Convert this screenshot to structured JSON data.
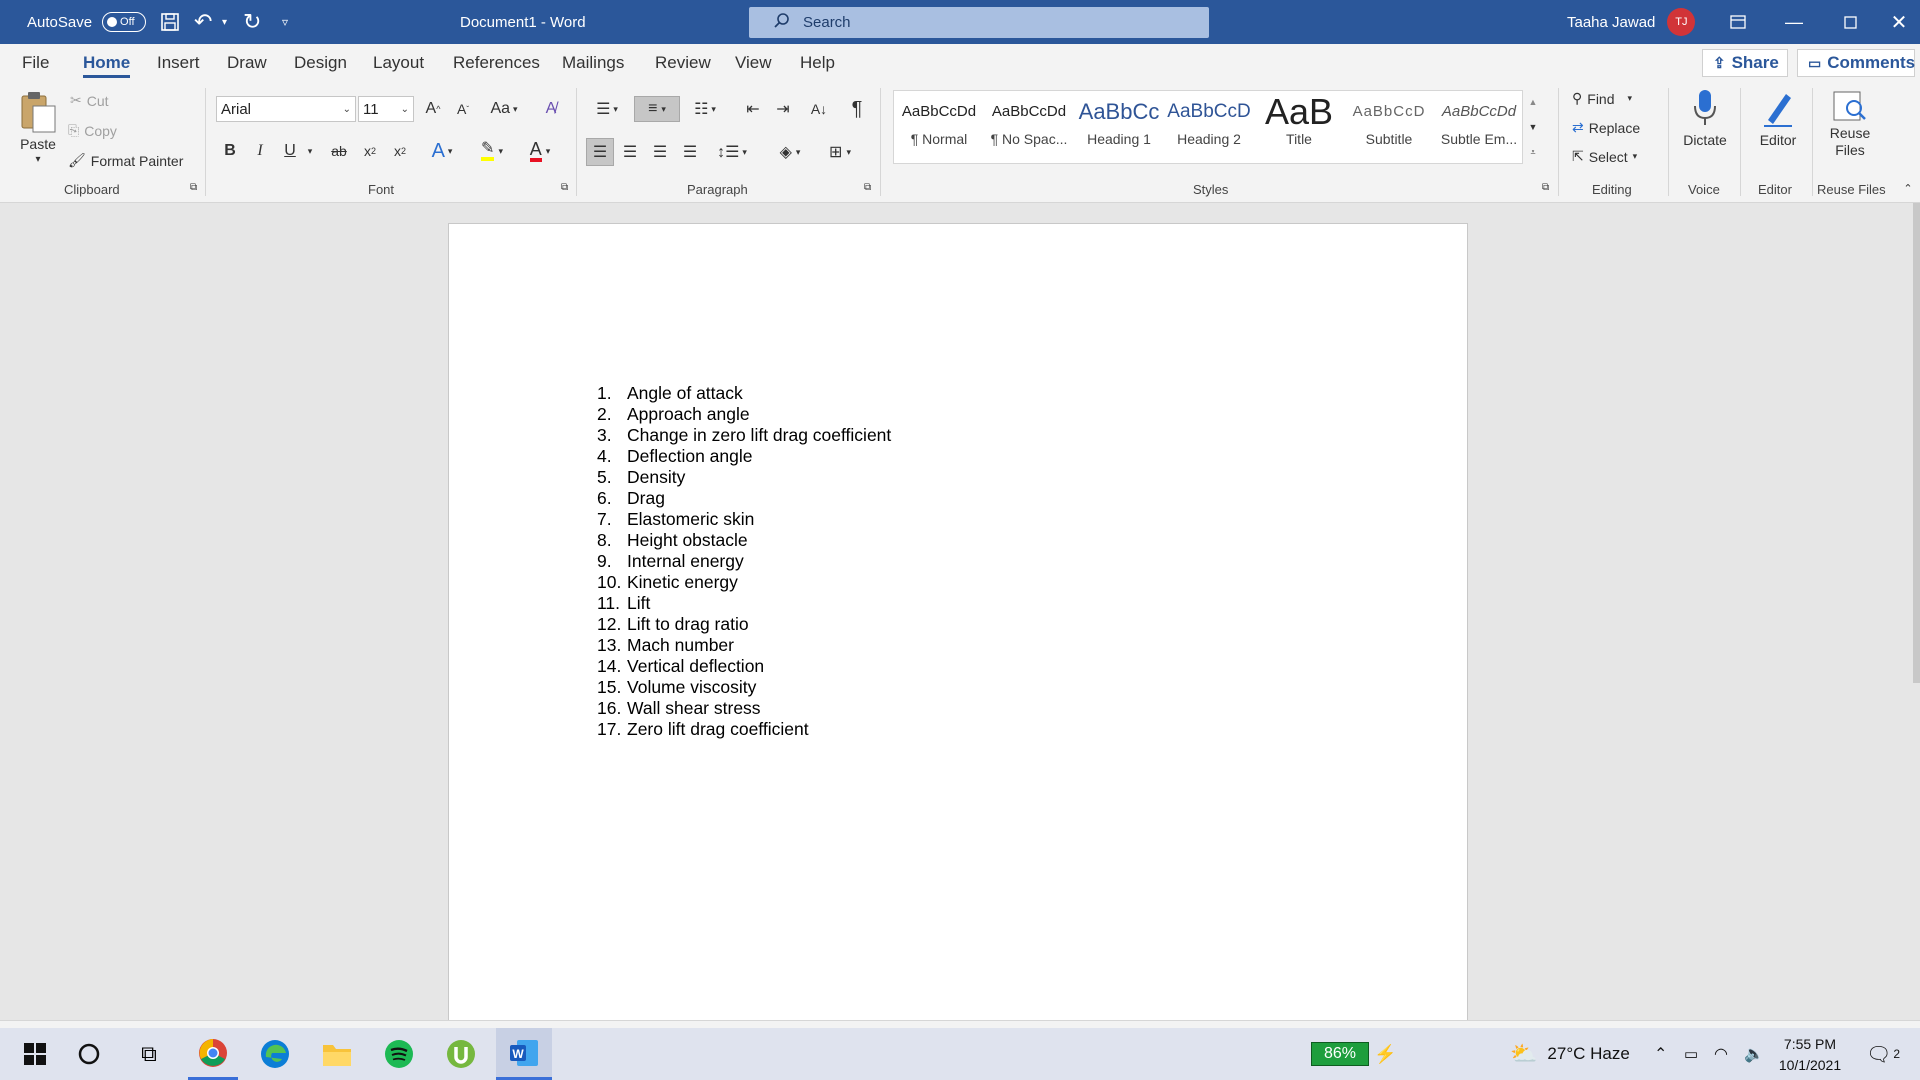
{
  "titlebar": {
    "autosave_label": "AutoSave",
    "autosave_state": "Off",
    "document_title": "Document1 - Word",
    "search_placeholder": "Search",
    "user_name": "Taaha Jawad",
    "user_initials": "TJ",
    "accent": "#2b579a"
  },
  "menu": {
    "tabs": [
      "File",
      "Home",
      "Insert",
      "Draw",
      "Design",
      "Layout",
      "References",
      "Mailings",
      "Review",
      "View",
      "Help"
    ],
    "active": "Home",
    "share_label": "Share",
    "comments_label": "Comments"
  },
  "ribbon": {
    "clipboard": {
      "paste": "Paste",
      "cut": "Cut",
      "copy": "Copy",
      "format_painter": "Format Painter",
      "label": "Clipboard"
    },
    "font": {
      "name": "Arial",
      "size": "11",
      "case_btn": "Aa",
      "label": "Font"
    },
    "paragraph": {
      "label": "Paragraph"
    },
    "styles": {
      "label": "Styles",
      "items": [
        {
          "preview": "AaBbCcDd",
          "name": "¶ Normal"
        },
        {
          "preview": "AaBbCcDd",
          "name": "¶ No Spac..."
        },
        {
          "preview": "AaBbCc",
          "name": "Heading 1"
        },
        {
          "preview": "AaBbCcD",
          "name": "Heading 2"
        },
        {
          "preview": "AaB",
          "name": "Title"
        },
        {
          "preview": "AaBbCcD",
          "name": "Subtitle"
        },
        {
          "preview": "AaBbCcDd",
          "name": "Subtle Em..."
        }
      ]
    },
    "editing": {
      "find": "Find",
      "replace": "Replace",
      "select": "Select",
      "label": "Editing"
    },
    "voice": {
      "dictate": "Dictate",
      "label": "Voice"
    },
    "editor": {
      "editor": "Editor",
      "label": "Editor"
    },
    "reuse": {
      "line1": "Reuse",
      "line2": "Files",
      "label": "Reuse Files"
    }
  },
  "document": {
    "items": [
      {
        "num": "1.",
        "text": "Angle of attack"
      },
      {
        "num": "2.",
        "text": "Approach angle"
      },
      {
        "num": "3.",
        "text": "Change in zero lift drag coefficient"
      },
      {
        "num": "4.",
        "text": "Deflection angle"
      },
      {
        "num": "5.",
        "text": "Density"
      },
      {
        "num": "6.",
        "text": "Drag"
      },
      {
        "num": "7.",
        "text": "Elastomeric skin"
      },
      {
        "num": "8.",
        "text": "Height obstacle"
      },
      {
        "num": "9.",
        "text": "Internal energy"
      },
      {
        "num": "10.",
        "text": "Kinetic energy"
      },
      {
        "num": "11.",
        "text": "Lift"
      },
      {
        "num": "12.",
        "text": "Lift to drag ratio"
      },
      {
        "num": "13.",
        "text": "Mach number"
      },
      {
        "num": "14.",
        "text": "Vertical deflection"
      },
      {
        "num": "15.",
        "text": "Volume viscosity"
      },
      {
        "num": "16.",
        "text": "Wall shear stress"
      },
      {
        "num": "17.",
        "text": "Zero lift drag coefficient"
      }
    ]
  },
  "taskbar": {
    "battery": "86%",
    "weather": "27°C  Haze",
    "time": "7:55 PM",
    "date": "10/1/2021",
    "notifications": "2"
  }
}
